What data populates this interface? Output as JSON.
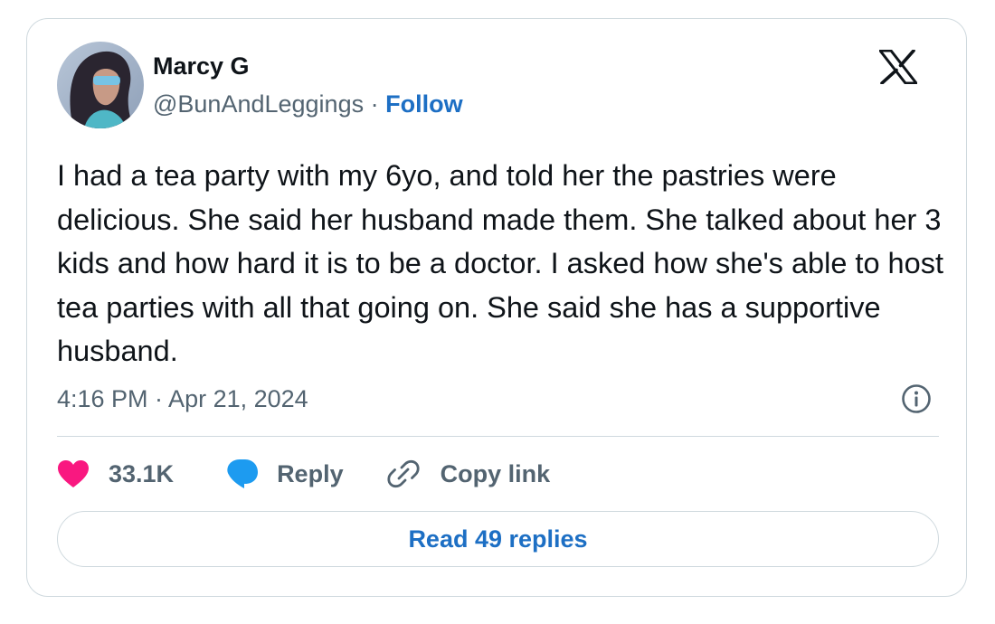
{
  "author": {
    "display_name": "Marcy G",
    "handle": "@BunAndLeggings",
    "separator": "·",
    "follow_label": "Follow",
    "avatar_icon": "profile-photo"
  },
  "logo_icon": "x-logo",
  "tweet": {
    "text": "I had a tea party with my 6yo, and told her the pastries were delicious. She said her husband made them. She talked about her 3 kids and how hard it is to be a doctor. I asked how she's able to host tea parties with all that going on. She said she has a supportive husband.",
    "timestamp": "4:16 PM · Apr 21, 2024"
  },
  "actions": {
    "like_count": "33.1K",
    "reply_label": "Reply",
    "copy_link_label": "Copy link"
  },
  "read_replies_label": "Read 49 replies",
  "colors": {
    "like": "#f91880",
    "reply": "#1d9bf0",
    "link": "#1d6fc4",
    "muted": "#536471",
    "border": "#cfd9de"
  }
}
